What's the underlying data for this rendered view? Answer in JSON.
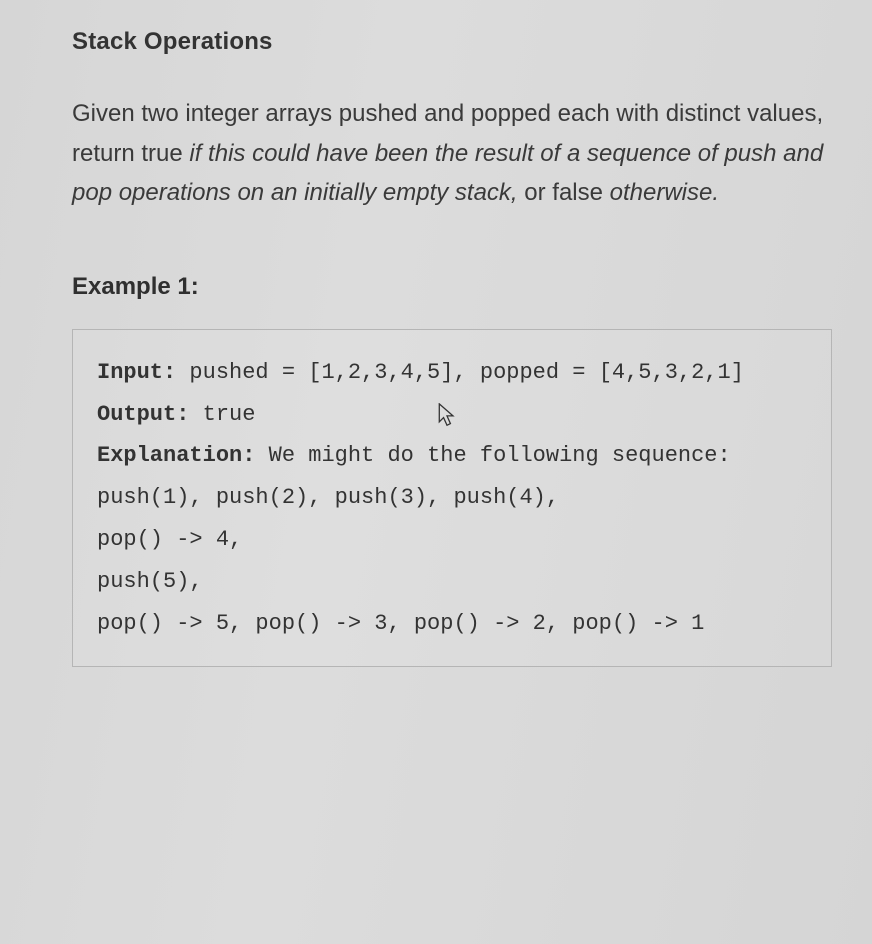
{
  "title": "Stack Operations",
  "description": {
    "part1": "Given two integer arrays pushed and popped each with distinct values, return true ",
    "italic1": "if this could have been the result of a sequence of push and pop operations on an initially empty stack,",
    "part2": " or false ",
    "italic2": "otherwise."
  },
  "example": {
    "label": "Example 1:",
    "input_label": "Input:",
    "input_value": " pushed = [1,2,3,4,5], popped = [4,5,3,2,1]",
    "output_label": "Output:",
    "output_value": " true",
    "explanation_label": "Explanation:",
    "explanation_value": " We might do the following sequence:\npush(1), push(2), push(3), push(4),\npop() -> 4,\npush(5),\npop() -> 5, pop() -> 3, pop() -> 2, pop() -> 1"
  }
}
